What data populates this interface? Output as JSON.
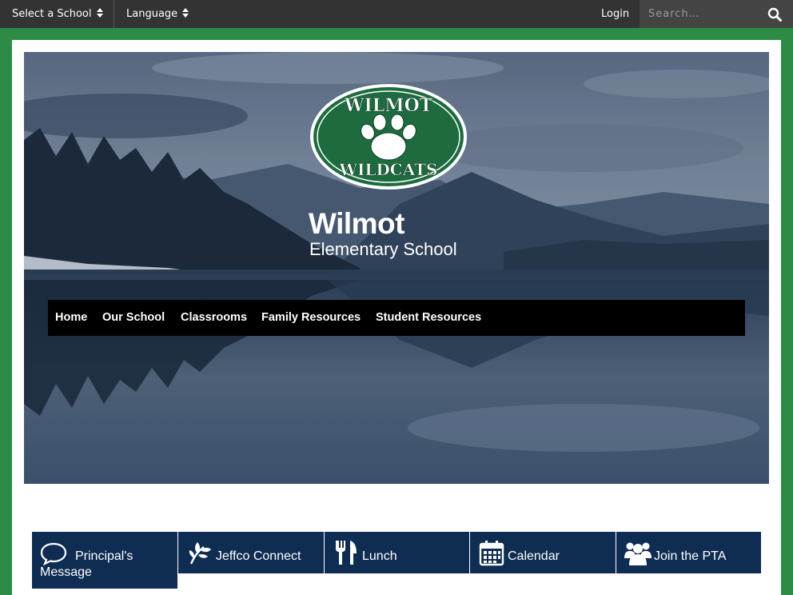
{
  "topbar": {
    "school_select_label": "Select a School",
    "language_label": "Language",
    "login_label": "Login",
    "search_placeholder": "Search…"
  },
  "hero": {
    "logo_text_top": "WILMOT",
    "logo_text_bottom": "WILDCATS",
    "school_name": "Wilmot",
    "school_subtitle": "Elementary School"
  },
  "nav": {
    "items": [
      {
        "label": "Home"
      },
      {
        "label": "Our School"
      },
      {
        "label": "Classrooms"
      },
      {
        "label": "Family Resources"
      },
      {
        "label": "Student Resources"
      }
    ]
  },
  "quick_links": [
    {
      "label": "Principal's Message",
      "icon": "speech-bubble-icon"
    },
    {
      "label": "Jeffco Connect",
      "icon": "plant-sprout-icon"
    },
    {
      "label": "Lunch",
      "icon": "fork-knife-icon"
    },
    {
      "label": "Calendar",
      "icon": "calendar-icon"
    },
    {
      "label": "Join the PTA",
      "icon": "people-group-icon"
    }
  ],
  "colors": {
    "page_green": "#2e8b46",
    "topbar": "#333333",
    "nav_bg": "#000000",
    "quick_link_bg": "#0f2d52",
    "logo_green": "#1d6b3e"
  }
}
